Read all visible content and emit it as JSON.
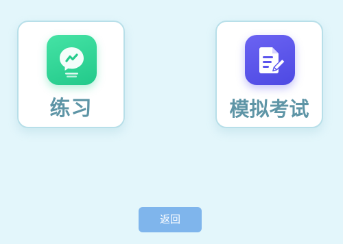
{
  "cards": [
    {
      "label": "练习",
      "icon": "lightbulb-chat-icon",
      "color": "#2fd495"
    },
    {
      "label": "模拟考试",
      "icon": "document-edit-icon",
      "color": "#5a54ec"
    }
  ],
  "back_button": {
    "label": "返回"
  },
  "colors": {
    "background": "#e3f6fb",
    "card_border": "#b8dfe9",
    "label_text": "#5e95a6",
    "button_bg": "#7fb5ec"
  }
}
